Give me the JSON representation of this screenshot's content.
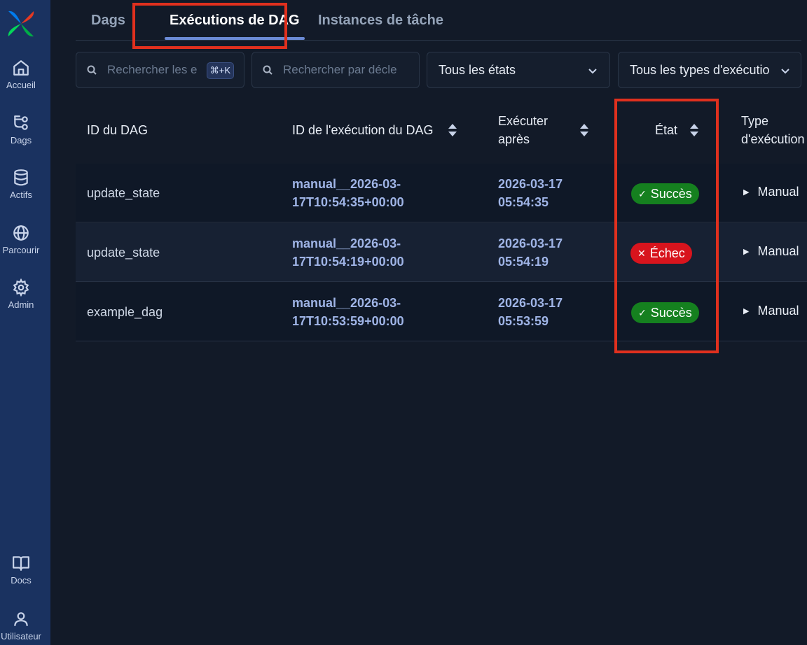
{
  "sidebar": {
    "items": [
      {
        "label": "Accueil",
        "icon": "home-icon"
      },
      {
        "label": "Dags",
        "icon": "dags-icon"
      },
      {
        "label": "Actifs",
        "icon": "database-icon"
      },
      {
        "label": "Parcourir",
        "icon": "globe-icon"
      },
      {
        "label": "Admin",
        "icon": "gear-icon"
      }
    ],
    "bottom": [
      {
        "label": "Docs",
        "icon": "book-icon"
      },
      {
        "label": "Utilisateur",
        "icon": "user-icon"
      }
    ]
  },
  "tabs": [
    {
      "label": "Dags"
    },
    {
      "label": "Exécutions de DAG",
      "active": true
    },
    {
      "label": "Instances de tâche"
    }
  ],
  "filters": {
    "search_dags_placeholder": "Rechercher les e",
    "shortcut": "⌘+K",
    "search_trigger_placeholder": "Rechercher par décle",
    "state_select": "Tous les états",
    "type_select": "Tous les types d'exécutio"
  },
  "table": {
    "headers": {
      "dag_id": "ID du DAG",
      "run_id": "ID de l'exécution du DAG",
      "run_after_1": "Exécuter",
      "run_after_2": "après",
      "state": "État",
      "run_type_1": "Type",
      "run_type_2": "d'exécution"
    },
    "rows": [
      {
        "dag_id": "update_state",
        "run_id_1": "manual__2026-03-",
        "run_id_2": "17T10:54:35+00:00",
        "after_1": "2026-03-17",
        "after_2": "05:54:35",
        "state": "Succès",
        "state_icon": "✓",
        "run_type": "Manual"
      },
      {
        "dag_id": "update_state",
        "run_id_1": "manual__2026-03-",
        "run_id_2": "17T10:54:19+00:00",
        "after_1": "2026-03-17",
        "after_2": "05:54:19",
        "state": "Échec",
        "state_icon": "✕",
        "run_type": "Manual"
      },
      {
        "dag_id": "example_dag",
        "run_id_1": "manual__2026-03-",
        "run_id_2": "17T10:53:59+00:00",
        "after_1": "2026-03-17",
        "after_2": "05:53:59",
        "state": "Succès",
        "state_icon": "✓",
        "run_type": "Manual"
      }
    ]
  },
  "colors": {
    "success": "#15801f",
    "failed": "#d8141d",
    "highlight": "#e0301e",
    "sidebar": "#1a3260"
  }
}
